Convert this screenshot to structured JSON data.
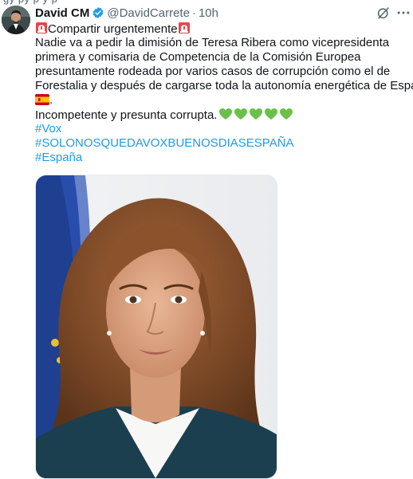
{
  "tweet": {
    "author_name": "David CM",
    "handle": "@DavidCarrete",
    "separator": "·",
    "time": "10h",
    "lines": {
      "l1": "Compartir urgentemente",
      "l2": "Nadie va a pedir la dimisión de Teresa Ribera  como vicepresidenta",
      "l3": "primera y comisaria de Competencia de la Comisión Europea",
      "l4": "presuntamente rodeada por varios casos de corrupción como el de",
      "l5": "Forestalia y después de cargarse toda la autonomía energética de España",
      "l6": ".",
      "l7": "Incompetente y presunta corrupta."
    },
    "hashtags": [
      "#Vox",
      "#SOLONOSQUEDAVOXBUENOSDIASESPAÑA",
      "#España"
    ],
    "icons": [
      "siren-icon",
      "spain-flag-icon",
      "green-heart-icon",
      "verified-badge-icon",
      "grok-icon",
      "more-icon"
    ],
    "colors": {
      "link": "#1d9bf0",
      "verified": "#1d9bf0",
      "heart": "#6bc04b",
      "muted": "#536471"
    }
  }
}
